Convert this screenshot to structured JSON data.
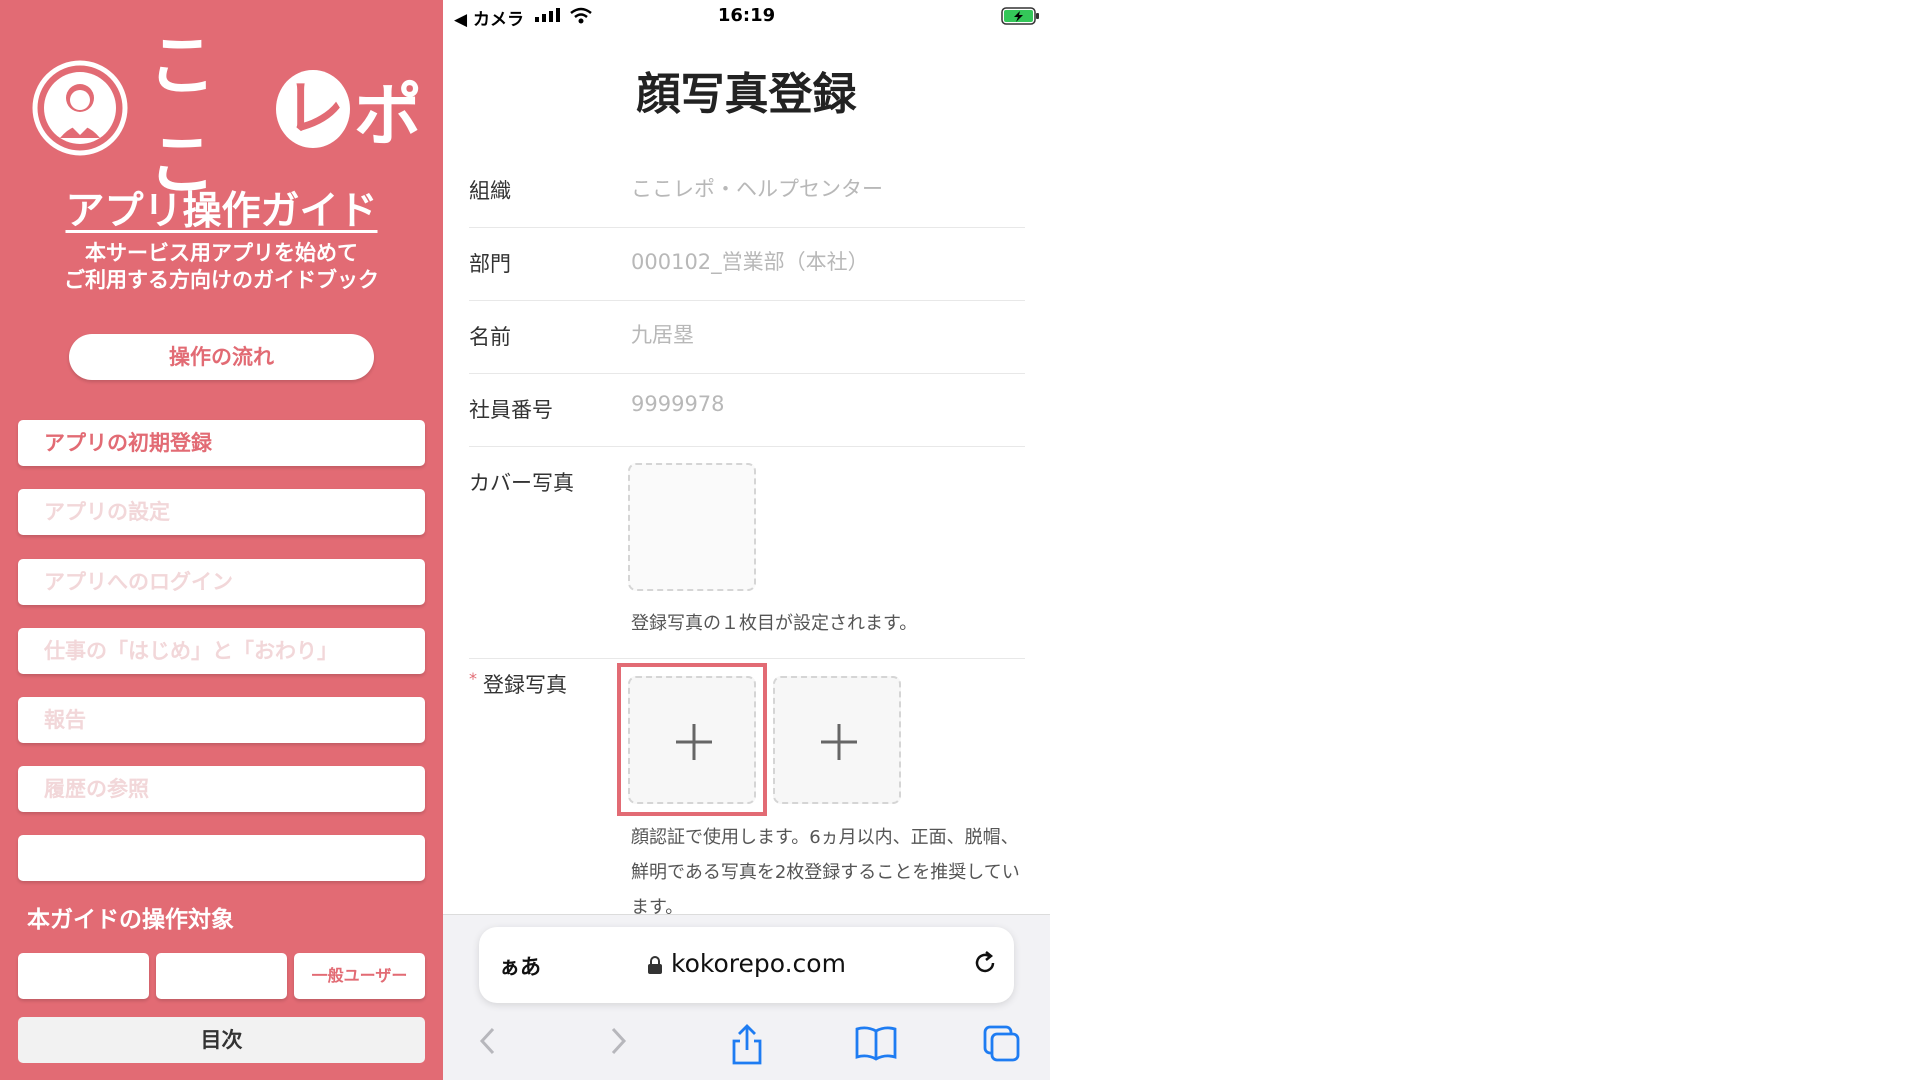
{
  "guide": {
    "logo_text_1": "ここ",
    "logo_text_re": "レ",
    "logo_text_2": "ポ",
    "title": "アプリ操作ガイド",
    "subtitle_line1": "本サービス用アプリを始めて",
    "subtitle_line2": "ご利用する方向けのガイドブック",
    "flow_button": "操作の流れ",
    "steps": [
      "アプリの初期登録",
      "アプリの設定",
      "アプリへのログイン",
      "仕事の「はじめ」と「おわり」",
      "報告",
      "履歴の参照",
      ""
    ],
    "target_heading": "本ガイドの操作対象",
    "targets": [
      "",
      "",
      "一般ユーザー"
    ],
    "toc_button": "目次",
    "colors": {
      "brand": "#e26b74"
    }
  },
  "phone": {
    "status": {
      "back": "◀ カメラ",
      "time": "16:19"
    },
    "title": "顔写真登録",
    "fields": [
      {
        "label": "組織",
        "value": "ここレポ・ヘルプセンター"
      },
      {
        "label": "部門",
        "value": "000102_営業部（本社）"
      },
      {
        "label": "名前",
        "value": "九居塁"
      },
      {
        "label": "社員番号",
        "value": "9999978"
      }
    ],
    "cover_label": "カバー写真",
    "cover_hint": "登録写真の１枚目が設定されます。",
    "photo_required_mark": "*",
    "photo_label": "登録写真",
    "photo_hint": "顔認証で使用します。6ヵ月以内、正面、脱帽、鮮明である写真を2枚登録することを推奨しています。",
    "browser": {
      "aa": "ぁあ",
      "url": "kokorepo.com"
    },
    "icons": [
      "back-arrow-icon",
      "forward-arrow-icon",
      "share-icon",
      "bookmarks-icon",
      "tabs-icon",
      "reload-icon",
      "lock-icon"
    ]
  }
}
